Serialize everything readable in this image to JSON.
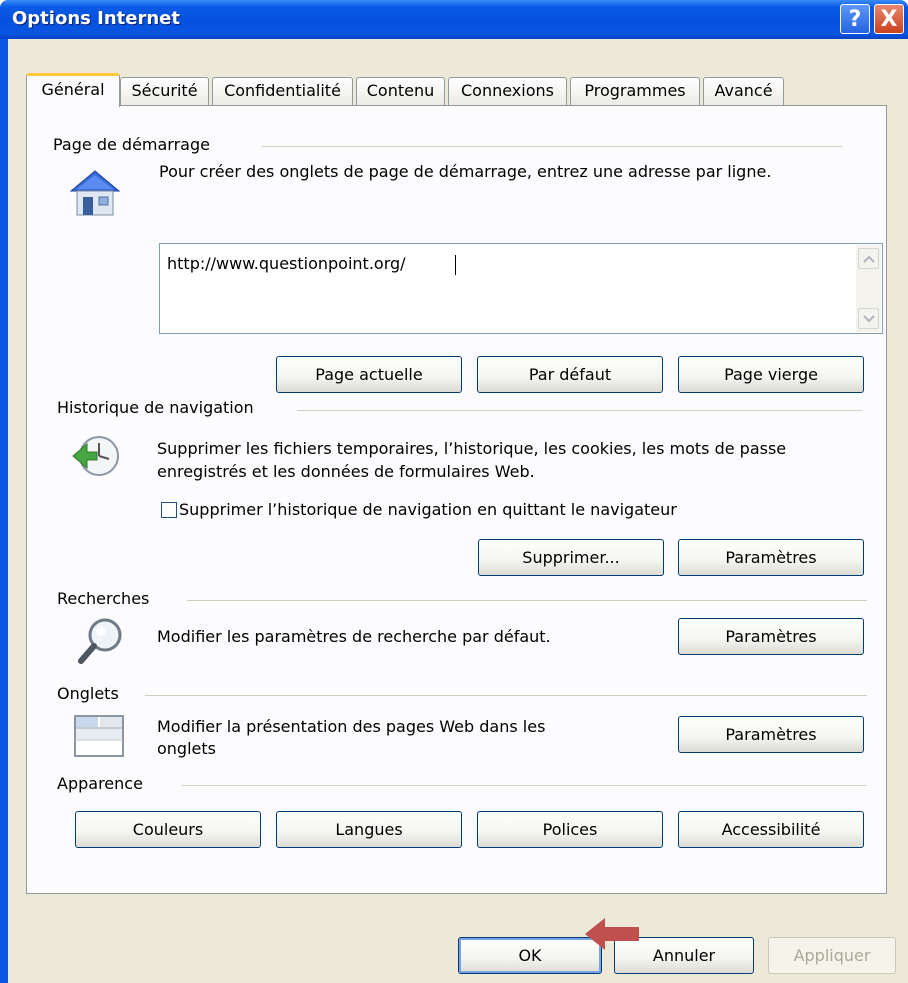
{
  "window": {
    "title": "Options Internet",
    "help_label": "?",
    "close_label": "X"
  },
  "tabs": [
    {
      "label": "Général",
      "active": true
    },
    {
      "label": "Sécurité"
    },
    {
      "label": "Confidentialité"
    },
    {
      "label": "Contenu"
    },
    {
      "label": "Connexions"
    },
    {
      "label": "Programmes"
    },
    {
      "label": "Avancé"
    }
  ],
  "home_page": {
    "group_label": "Page de démarrage",
    "description": "Pour créer des onglets de page de démarrage, entrez une adresse par ligne.",
    "url_value": "http://www.questionpoint.org/",
    "icon": "home-icon",
    "buttons": {
      "current": "Page actuelle",
      "default": "Par défaut",
      "blank": "Page vierge"
    }
  },
  "history": {
    "group_label": "Historique de navigation",
    "description_line1": "Supprimer les fichiers temporaires, l’historique, les cookies, les mots de passe",
    "description_line2": "enregistrés et les données de formulaires Web.",
    "checkbox_label": "Supprimer l’historique de navigation en quittant le navigateur",
    "checkbox_checked": false,
    "icon": "history-clock-icon",
    "buttons": {
      "delete": "Supprimer...",
      "settings": "Paramètres"
    }
  },
  "search": {
    "group_label": "Recherches",
    "description": "Modifier les paramètres de recherche par défaut.",
    "icon": "magnifier-icon",
    "settings_button": "Paramètres"
  },
  "tabs_section": {
    "group_label": "Onglets",
    "description_line1": "Modifier la présentation des pages Web dans les",
    "description_line2": "onglets",
    "icon": "tabbed-window-icon",
    "settings_button": "Paramètres"
  },
  "appearance": {
    "group_label": "Apparence",
    "buttons": {
      "colors": "Couleurs",
      "languages": "Langues",
      "fonts": "Polices",
      "accessibility": "Accessibilité"
    }
  },
  "footer": {
    "ok": "OK",
    "cancel": "Annuler",
    "apply": "Appliquer"
  },
  "colors": {
    "title_bar": "#0a55e3",
    "dialog_bg": "#ece9d8",
    "active_tab_accent": "#ffc83c",
    "annotation_arrow": "#c0504d"
  }
}
